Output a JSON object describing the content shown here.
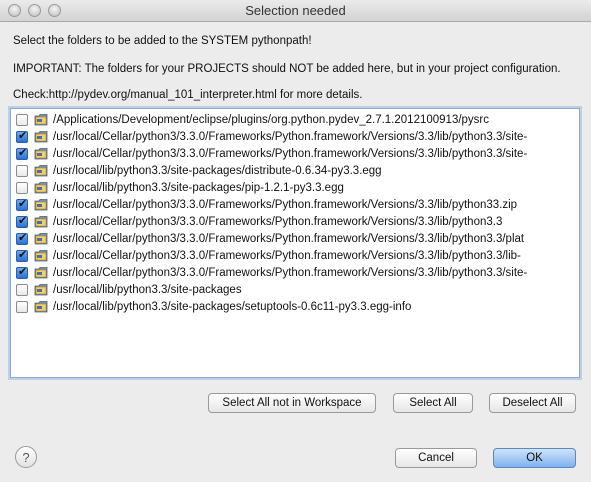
{
  "window": {
    "title": "Selection needed"
  },
  "messages": {
    "line1": "Select the folders to be added to the SYSTEM pythonpath!",
    "line2": "IMPORTANT: The folders for your PROJECTS should NOT be added here, but in your project configuration.",
    "line3": "Check:http://pydev.org/manual_101_interpreter.html for more details."
  },
  "folders": [
    {
      "path": "/Applications/Development/eclipse/plugins/org.python.pydev_2.7.1.2012100913/pysrc",
      "checked": false
    },
    {
      "path": "/usr/local/Cellar/python3/3.3.0/Frameworks/Python.framework/Versions/3.3/lib/python3.3/site-",
      "checked": true
    },
    {
      "path": "/usr/local/Cellar/python3/3.3.0/Frameworks/Python.framework/Versions/3.3/lib/python3.3/site-",
      "checked": true
    },
    {
      "path": "/usr/local/lib/python3.3/site-packages/distribute-0.6.34-py3.3.egg",
      "checked": false
    },
    {
      "path": "/usr/local/lib/python3.3/site-packages/pip-1.2.1-py3.3.egg",
      "checked": false
    },
    {
      "path": "/usr/local/Cellar/python3/3.3.0/Frameworks/Python.framework/Versions/3.3/lib/python33.zip",
      "checked": true
    },
    {
      "path": "/usr/local/Cellar/python3/3.3.0/Frameworks/Python.framework/Versions/3.3/lib/python3.3",
      "checked": true
    },
    {
      "path": "/usr/local/Cellar/python3/3.3.0/Frameworks/Python.framework/Versions/3.3/lib/python3.3/plat",
      "checked": true
    },
    {
      "path": "/usr/local/Cellar/python3/3.3.0/Frameworks/Python.framework/Versions/3.3/lib/python3.3/lib-",
      "checked": true
    },
    {
      "path": "/usr/local/Cellar/python3/3.3.0/Frameworks/Python.framework/Versions/3.3/lib/python3.3/site-",
      "checked": true
    },
    {
      "path": "/usr/local/lib/python3.3/site-packages",
      "checked": false
    },
    {
      "path": "/usr/local/lib/python3.3/site-packages/setuptools-0.6c11-py3.3.egg-info",
      "checked": false
    }
  ],
  "buttons": {
    "select_all_not_in_workspace": "Select All not in Workspace",
    "select_all": "Select All",
    "deselect_all": "Deselect All",
    "cancel": "Cancel",
    "ok": "OK",
    "help": "?"
  },
  "icons": {
    "folder": "folder-icon",
    "help": "help-icon"
  }
}
